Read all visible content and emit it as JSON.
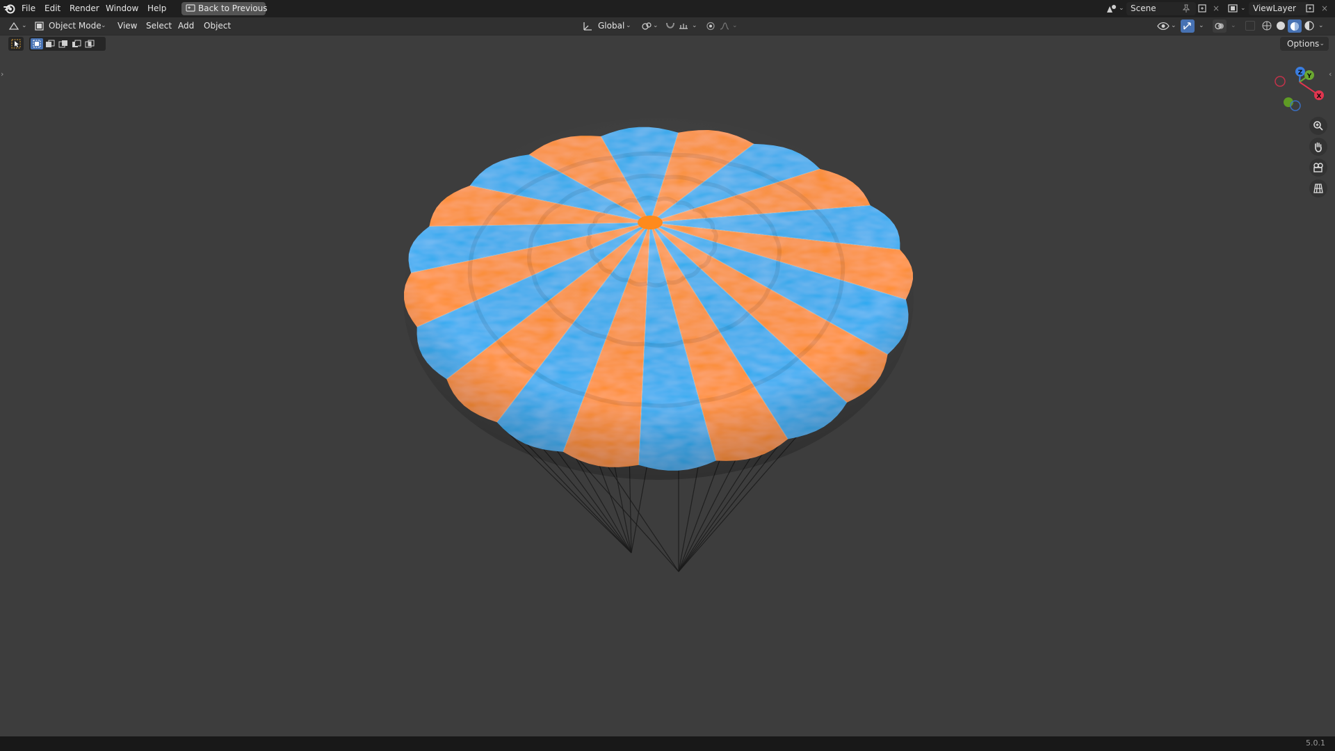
{
  "topbar": {
    "menu": [
      "File",
      "Edit",
      "Render",
      "Window",
      "Help"
    ],
    "back_button": "Back to Previous",
    "scene_field": "Scene",
    "viewlayer_field": "ViewLayer"
  },
  "header": {
    "mode": "Object Mode",
    "menus": [
      "View",
      "Select",
      "Add",
      "Object"
    ],
    "orientation": "Global",
    "options": "Options"
  },
  "gizmo": {
    "z": "Z",
    "y": "Y",
    "x": "X"
  },
  "canopy": {
    "colors": {
      "orange": "#ff8a1c",
      "blue": "#1fa9f2"
    },
    "gore_count": 20
  },
  "status": {
    "version": "5.0.1"
  },
  "colors": {
    "accent": "#4772b3",
    "background": "#3d3d3d"
  }
}
